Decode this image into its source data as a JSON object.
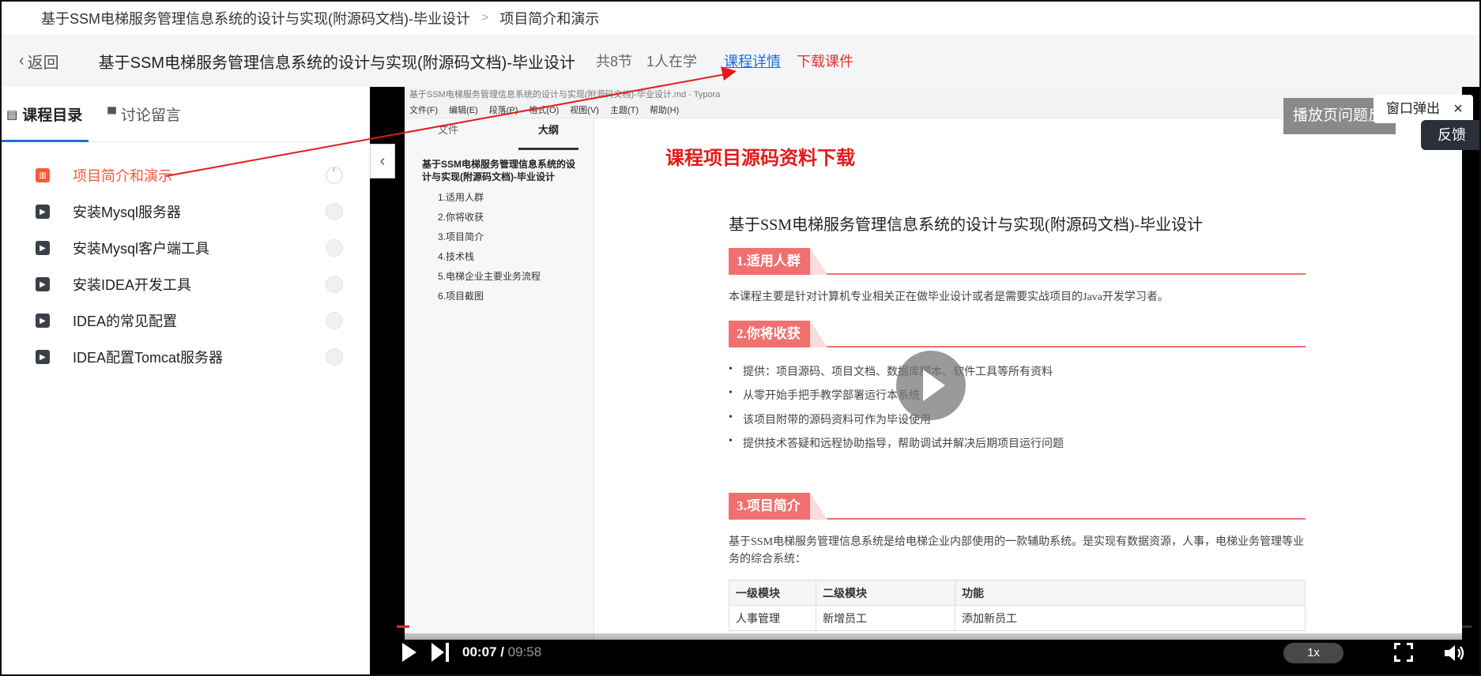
{
  "breadcrumb": {
    "course": "基于SSM电梯服务管理信息系统的设计与实现(附源码文档)-毕业设计",
    "separator": ">",
    "current": "项目简介和演示"
  },
  "header": {
    "back_label": "返回",
    "title": "基于SSM电梯服务管理信息系统的设计与实现(附源码文档)-毕业设计",
    "sections": "共8节",
    "learners": "1人在学",
    "detail_link": "课程详情",
    "download_link": "下载课件"
  },
  "sidebar": {
    "tabs": [
      {
        "label": "课程目录",
        "icon": "list-icon"
      },
      {
        "label": "讨论留言",
        "icon": "comment-icon"
      }
    ],
    "lessons": [
      {
        "label": "项目简介和演示",
        "active": true
      },
      {
        "label": "安装Mysql服务器"
      },
      {
        "label": "安装Mysql客户端工具"
      },
      {
        "label": "安装IDEA开发工具"
      },
      {
        "label": "IDEA的常见配置"
      },
      {
        "label": "IDEA配置Tomcat服务器"
      }
    ]
  },
  "video": {
    "typora": {
      "window_title": "基于SSM电梯服务管理信息系统的设计与实现(附源码文档)-毕业设计.md - Typora",
      "menu": [
        "文件(F)",
        "编辑(E)",
        "段落(P)",
        "格式(O)",
        "视图(V)",
        "主题(T)",
        "帮助(H)"
      ],
      "sidebar_tabs": [
        "文件",
        "大纲"
      ],
      "outline_root": "基于SSM电梯服务管理信息系统的设计与实现(附源码文档)-毕业设计",
      "outline_items": [
        "1.适用人群",
        "2.你将收获",
        "3.项目简介",
        "4.技术栈",
        "5.电梯企业主要业务流程",
        "6.项目截图"
      ],
      "doc_header": "课程项目源码资料下载",
      "doc_title": "基于SSM电梯服务管理信息系统的设计与实现(附源码文档)-毕业设计",
      "sec1_title": "1.适用人群",
      "sec1_text": "本课程主要是针对计算机专业相关正在做毕业设计或者是需要实战项目的Java开发学习者。",
      "sec2_title": "2.你将收获",
      "sec2_bullets": [
        "提供：项目源码、项目文档、数据库脚本、软件工具等所有资料",
        "从零开始手把手教学部署运行本系统",
        "该项目附带的源码资料可作为毕设使用",
        "提供技术答疑和远程协助指导，帮助调试并解决后期项目运行问题"
      ],
      "sec3_title": "3.项目简介",
      "sec3_text": "基于SSM电梯服务管理信息系统是给电梯企业内部使用的一款辅助系统。是实现有数据资源，人事，电梯业务管理等业务的综合系统：",
      "table_headers": [
        "一级模块",
        "二级模块",
        "功能"
      ],
      "table_row": [
        "人事管理",
        "新增员工",
        "添加新员工"
      ]
    },
    "report_label": "播放页问题反馈",
    "popup_label": "窗口弹出",
    "popup_close": "×",
    "feedback_label": "反馈",
    "current_time": "00:07",
    "total_time": "09:58",
    "progress_fraction": 0.012,
    "speed": "1x"
  }
}
